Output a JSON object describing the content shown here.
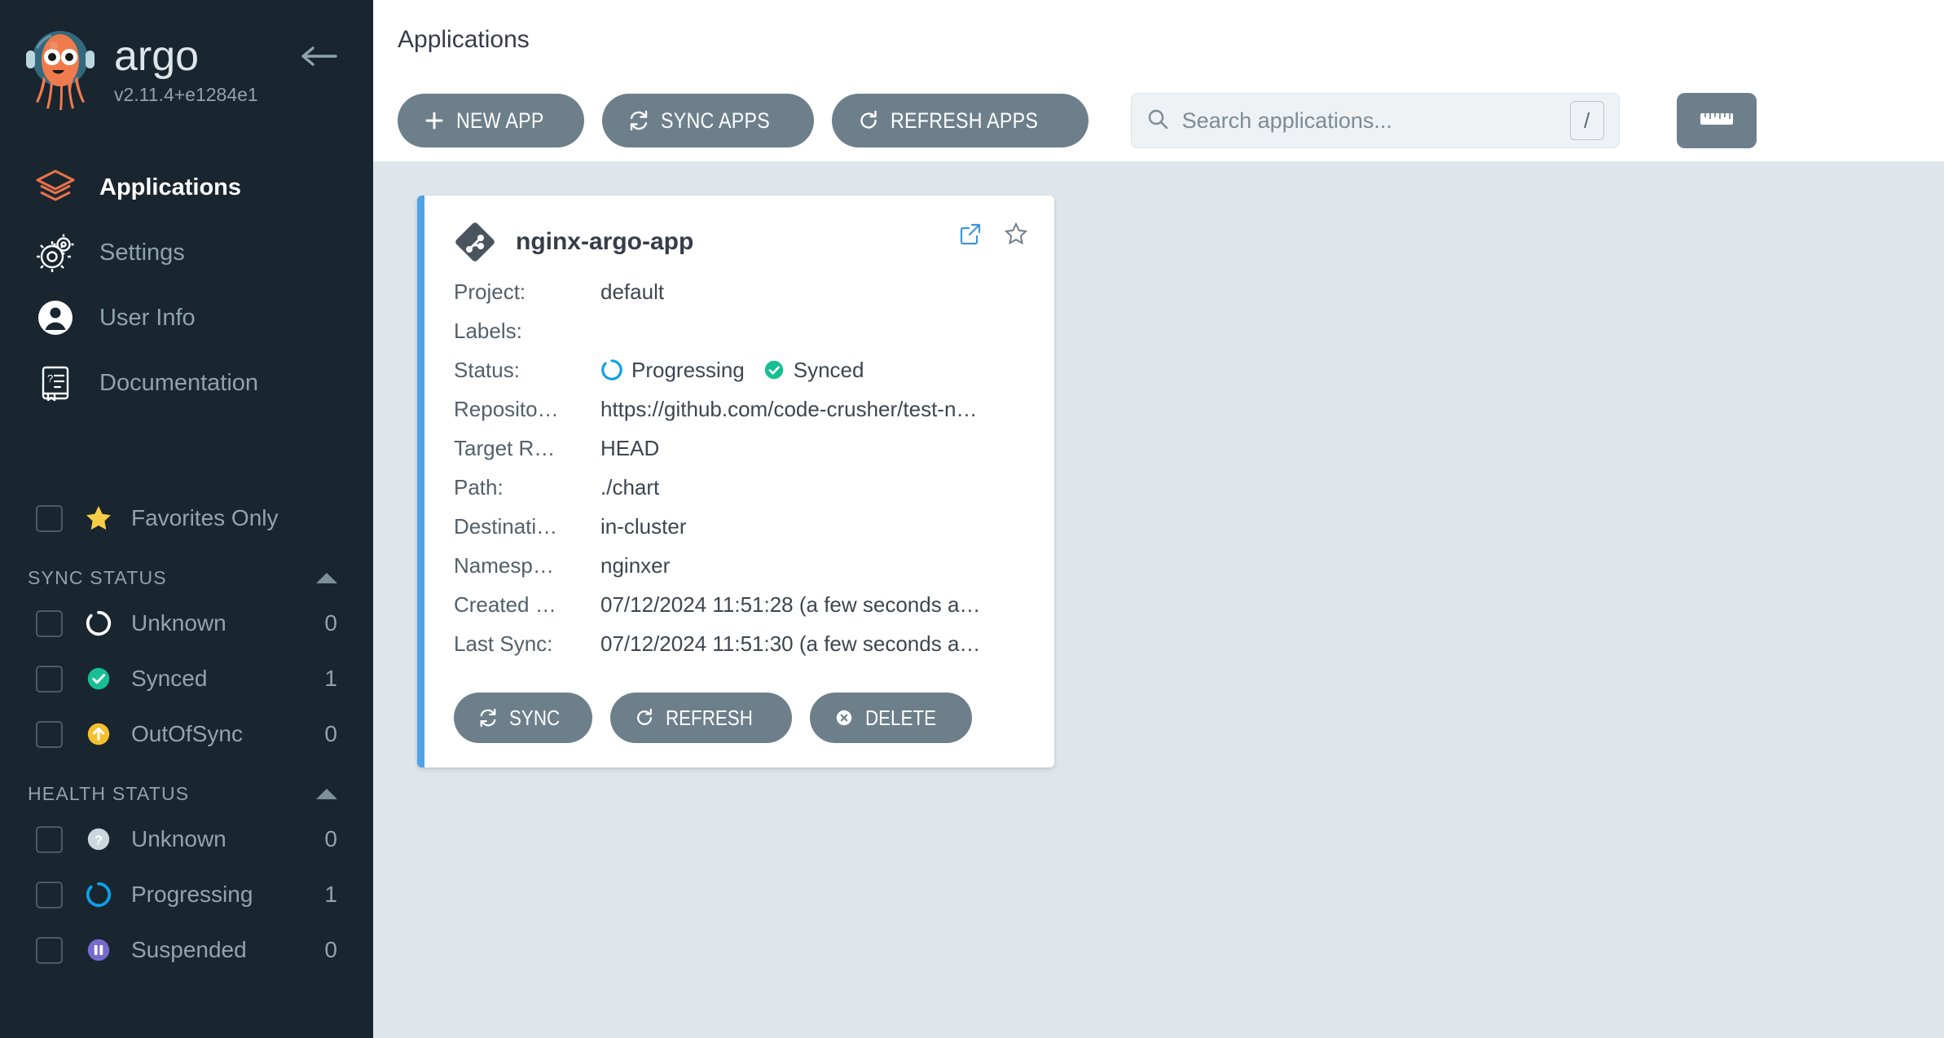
{
  "brand": {
    "name": "argo",
    "version": "v2.11.4+e1284e1",
    "logo_icon": "argo-octopus-logo",
    "collapse_icon": "arrow-left-icon"
  },
  "sidebar": {
    "nav": [
      {
        "label": "Applications",
        "icon": "layers-icon",
        "active": true
      },
      {
        "label": "Settings",
        "icon": "gears-icon",
        "active": false
      },
      {
        "label": "User Info",
        "icon": "user-circle-icon",
        "active": false
      },
      {
        "label": "Documentation",
        "icon": "book-question-icon",
        "active": false
      }
    ],
    "favorites": {
      "label": "Favorites Only",
      "icon": "star-icon",
      "checked": false
    },
    "sections": [
      {
        "title": "SYNC STATUS",
        "collapse_icon": "chevron-up-icon",
        "items": [
          {
            "label": "Unknown",
            "count": "0",
            "icon": "circle-dashed-icon",
            "color": "#ffffff"
          },
          {
            "label": "Synced",
            "count": "1",
            "icon": "check-circle-icon",
            "color": "#18be94"
          },
          {
            "label": "OutOfSync",
            "count": "0",
            "icon": "arrow-up-circle-icon",
            "color": "#f4c030"
          }
        ]
      },
      {
        "title": "HEALTH STATUS",
        "collapse_icon": "chevron-up-icon",
        "items": [
          {
            "label": "Unknown",
            "count": "0",
            "icon": "question-circle-icon",
            "color": "#ccd6dd"
          },
          {
            "label": "Progressing",
            "count": "1",
            "icon": "circle-spinner-icon",
            "color": "#0da0e8"
          },
          {
            "label": "Suspended",
            "count": "0",
            "icon": "pause-circle-icon",
            "color": "#766bcd"
          }
        ]
      }
    ]
  },
  "header": {
    "title": "Applications"
  },
  "toolbar": {
    "new_app": {
      "label": "NEW APP",
      "icon": "plus-icon"
    },
    "sync_apps": {
      "label": "SYNC APPS",
      "icon": "sync-icon"
    },
    "refresh_apps": {
      "label": "REFRESH APPS",
      "icon": "refresh-icon"
    },
    "search": {
      "placeholder": "Search applications...",
      "value": "",
      "icon": "search-icon",
      "shortcut": "/"
    },
    "ruler": {
      "icon": "ruler-icon"
    }
  },
  "application": {
    "name": "nginx-argo-app",
    "icon": "git-diamond-icon",
    "external_link_icon": "external-link-icon",
    "favorite_icon": "star-outline-icon",
    "fields": [
      {
        "key": "Project:",
        "value": "default"
      },
      {
        "key": "Labels:",
        "value": ""
      },
      {
        "key": "Status:",
        "value": "",
        "statuses": [
          {
            "label": "Progressing",
            "icon": "circle-spinner-icon",
            "color": "#0da0e8"
          },
          {
            "label": "Synced",
            "icon": "check-circle-icon",
            "color": "#18be94"
          }
        ]
      },
      {
        "key": "Reposito…",
        "value": "https://github.com/code-crusher/test-n…"
      },
      {
        "key": "Target R…",
        "value": "HEAD"
      },
      {
        "key": "Path:",
        "value": "./chart"
      },
      {
        "key": "Destinati…",
        "value": "in-cluster"
      },
      {
        "key": "Namesp…",
        "value": "nginxer"
      },
      {
        "key": "Created …",
        "value": "07/12/2024 11:51:28  (a few seconds a…"
      },
      {
        "key": "Last Sync:",
        "value": "07/12/2024 11:51:30  (a few seconds a…"
      }
    ],
    "buttons": [
      {
        "label": "SYNC",
        "icon": "sync-icon"
      },
      {
        "label": "REFRESH",
        "icon": "refresh-icon"
      },
      {
        "label": "DELETE",
        "icon": "delete-circle-icon"
      }
    ]
  },
  "colors": {
    "sidebar_bg": "#19252f",
    "content_bg": "#dfe6eb",
    "accent_orange": "#e9734b",
    "card_border": "#4da2e8",
    "button_bg": "#6d7f8b"
  }
}
